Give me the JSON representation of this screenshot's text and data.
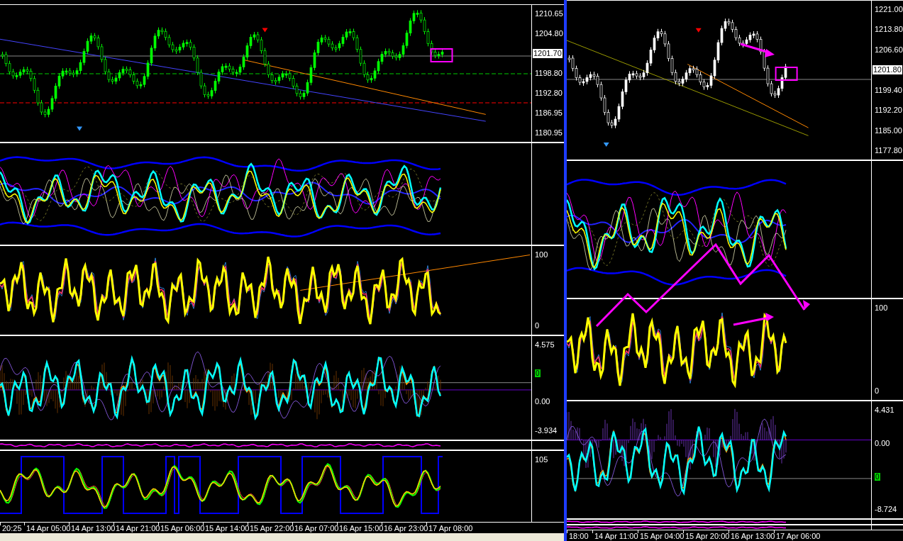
{
  "charts": [
    {
      "panes": [
        {
          "kind": "price",
          "labels": [
            "1210.65",
            "1204.80",
            "1198.80",
            "1192.80",
            "1186.95",
            "1180.95"
          ],
          "current": "1201.70"
        },
        {
          "kind": "bands"
        },
        {
          "kind": "stoch",
          "labels": [
            "100",
            "0"
          ]
        },
        {
          "kind": "macd",
          "labels": [
            "4.575",
            "0.00",
            "-3.934"
          ],
          "marker": "0"
        },
        {
          "kind": "thin"
        },
        {
          "kind": "osc",
          "labels": [
            "105"
          ]
        }
      ],
      "time_labels": [
        "20:25",
        "14 Apr 05:00",
        "14 Apr 13:00",
        "14 Apr 21:00",
        "15 Apr 06:00",
        "15 Apr 14:00",
        "15 Apr 22:00",
        "16 Apr 07:00",
        "16 Apr 15:00",
        "16 Apr 23:00",
        "17 Apr 08:00"
      ]
    },
    {
      "panes": [
        {
          "kind": "price",
          "labels": [
            "1221.00",
            "1213.80",
            "1206.60",
            "1199.40",
            "1192.20",
            "1185.00",
            "1177.80"
          ],
          "current": "1201.80"
        },
        {
          "kind": "bands"
        },
        {
          "kind": "stoch",
          "labels": [
            "100",
            "0"
          ]
        },
        {
          "kind": "macd",
          "labels": [
            "4.431",
            "0.00",
            "-8.724"
          ],
          "marker": "0"
        },
        {
          "kind": "thin"
        },
        {
          "kind": "thin"
        }
      ],
      "time_labels": [
        "18:00",
        "14 Apr 11:00",
        "15 Apr 04:00",
        "15 Apr 20:00",
        "16 Apr 13:00",
        "17 Apr 06:00"
      ]
    }
  ]
}
